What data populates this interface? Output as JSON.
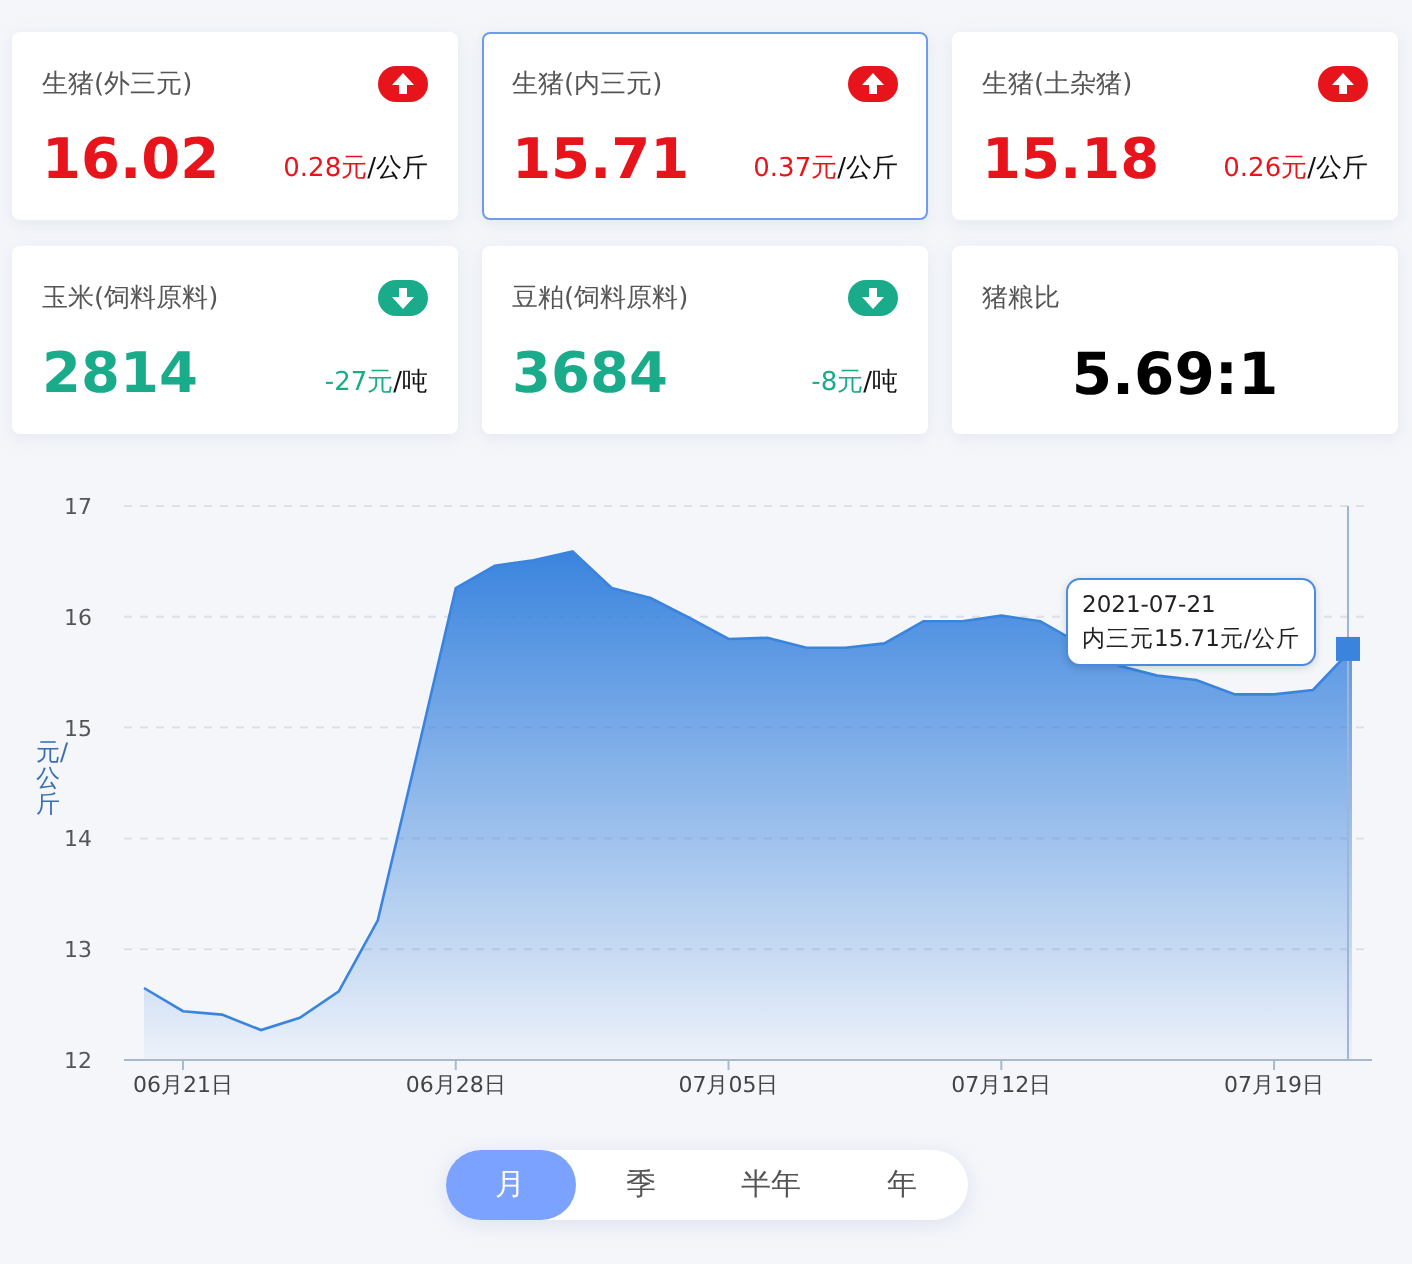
{
  "cards": [
    {
      "kind": "up",
      "title": "生猪(外三元)",
      "value": "16.02",
      "change": "0.28元",
      "unit": "/公斤",
      "selected": false
    },
    {
      "kind": "up",
      "title": "生猪(内三元)",
      "value": "15.71",
      "change": "0.37元",
      "unit": "/公斤",
      "selected": true
    },
    {
      "kind": "up",
      "title": "生猪(土杂猪)",
      "value": "15.18",
      "change": "0.26元",
      "unit": "/公斤",
      "selected": false
    },
    {
      "kind": "down",
      "title": "玉米(饲料原料)",
      "value": "2814",
      "change": "-27元",
      "unit": "/吨",
      "selected": false
    },
    {
      "kind": "down",
      "title": "豆粕(饲料原料)",
      "value": "3684",
      "change": "-8元",
      "unit": "/吨",
      "selected": false
    },
    {
      "kind": "ratio",
      "title": "猪粮比",
      "value": "5.69:1",
      "selected": false
    }
  ],
  "chart": {
    "chart_data": {
      "type": "area",
      "ylabel": "元/公斤",
      "categories": [
        null,
        "06月21日",
        null,
        null,
        null,
        null,
        null,
        null,
        "06月28日",
        null,
        null,
        null,
        null,
        null,
        null,
        "07月05日",
        null,
        null,
        null,
        null,
        null,
        null,
        "07月12日",
        null,
        null,
        null,
        null,
        null,
        null,
        "07月19日",
        null,
        null
      ],
      "series": [
        {
          "color": "#3a84de",
          "values": [
            12.65,
            12.44,
            12.41,
            12.27,
            12.38,
            12.62,
            13.26,
            14.75,
            16.26,
            16.46,
            16.51,
            16.59,
            16.26,
            16.17,
            15.99,
            15.8,
            15.81,
            15.72,
            15.72,
            15.76,
            15.96,
            15.96,
            16.01,
            15.96,
            null,
            15.56,
            15.47,
            15.43,
            15.3,
            15.3,
            15.34,
            15.71
          ]
        }
      ],
      "ylim": [
        12,
        17
      ],
      "grid": true,
      "yticks": [
        12,
        13,
        14,
        15,
        16,
        17
      ]
    },
    "tooltip": {
      "date": "2021-07-21",
      "text": "内三元15.71元/公斤"
    }
  },
  "periods": [
    {
      "label": "月",
      "selected": true
    },
    {
      "label": "季",
      "selected": false
    },
    {
      "label": "半年",
      "selected": false
    },
    {
      "label": "年",
      "selected": false
    }
  ]
}
